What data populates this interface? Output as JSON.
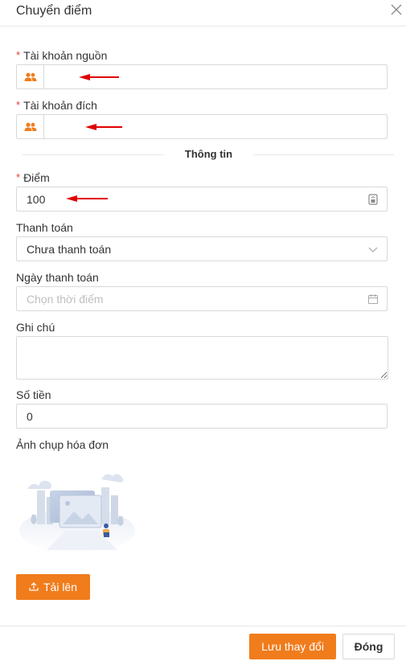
{
  "dialog": {
    "title": "Chuyển điểm"
  },
  "form": {
    "required_mark": "*",
    "source_account": {
      "label": "Tài khoản nguồn",
      "value": ""
    },
    "target_account": {
      "label": "Tài khoản đích",
      "value": ""
    },
    "section_title": "Thông tin",
    "points": {
      "label": "Điểm",
      "value": "100"
    },
    "payment": {
      "label": "Thanh toán",
      "value": "Chưa thanh toán"
    },
    "payment_date": {
      "label": "Ngày thanh toán",
      "placeholder": "Chọn thời điểm"
    },
    "note": {
      "label": "Ghi chú",
      "value": ""
    },
    "amount": {
      "label": "Số tiền",
      "value": "0"
    },
    "invoice_photo": {
      "label": "Ảnh chụp hóa đơn"
    }
  },
  "buttons": {
    "upload": "Tải lên",
    "save": "Lưu thay đổi",
    "close": "Đóng"
  },
  "colors": {
    "accent": "#f07c1c",
    "required": "#e53935",
    "annotation_arrow": "#e00000",
    "border": "#d9d9d9"
  },
  "icons": {
    "close": "close-icon",
    "account_prefix": "users-icon",
    "points_suffix": "number-icon",
    "payment_suffix": "chevron-down-icon",
    "date_suffix": "calendar-icon",
    "upload": "upload-icon",
    "illustration": "empty-image-illustration"
  }
}
